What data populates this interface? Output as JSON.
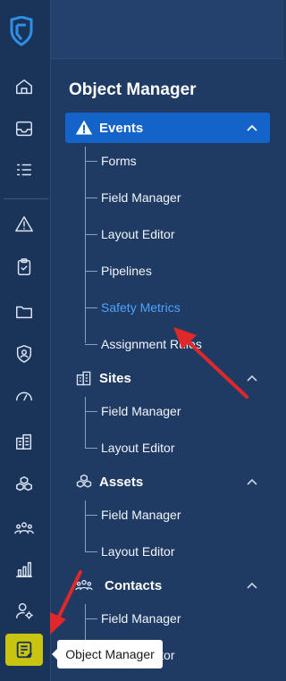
{
  "rail": {
    "icons": [
      "logo-shield-icon",
      "home-icon",
      "inbox-icon",
      "list-icon",
      "warning-icon",
      "clipboard-check-icon",
      "folder-icon",
      "shield-user-icon",
      "gauge-icon",
      "buildings-icon",
      "cubes-icon",
      "people-icon",
      "bar-chart-icon",
      "user-settings-icon",
      "object-manager-icon"
    ],
    "active_item": "object-manager-icon",
    "active_color": "#c8c40f"
  },
  "panel": {
    "title": "Object Manager",
    "groups": [
      {
        "label": "Events",
        "icon": "warning-icon",
        "expanded": true,
        "items": [
          "Forms",
          "Field Manager",
          "Layout Editor",
          "Pipelines",
          "Safety Metrics",
          "Assignment Rules"
        ]
      },
      {
        "label": "Sites",
        "icon": "buildings-icon",
        "expanded": true,
        "items": [
          "Field Manager",
          "Layout Editor"
        ]
      },
      {
        "label": "Assets",
        "icon": "cubes-icon",
        "expanded": true,
        "items": [
          "Field Manager",
          "Layout Editor"
        ]
      },
      {
        "label": "Contacts",
        "icon": "people-icon",
        "expanded": true,
        "items": [
          "Field Manager",
          "Layout Editor"
        ]
      }
    ],
    "highlighted_item": "Safety Metrics",
    "highlight_color": "#4ea3ff"
  },
  "tooltip": {
    "text": "Object Manager"
  },
  "colors": {
    "rail_bg": "#1a3358",
    "panel_bg": "#1f3a63",
    "selected_group_bg": "#1463c8",
    "annotation_arrow": "#e0282b"
  }
}
